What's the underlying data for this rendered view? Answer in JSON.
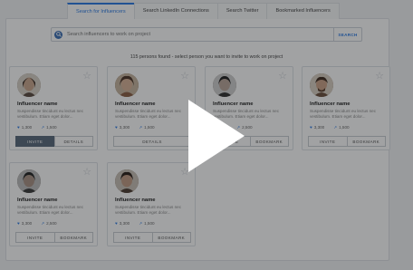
{
  "tabs": [
    {
      "label": "Search for Influencers"
    },
    {
      "label": "Search LinkedIn Connections"
    },
    {
      "label": "Search Twitter"
    },
    {
      "label": "Bookmarked Influencers"
    }
  ],
  "search": {
    "placeholder": "Search influencers to work on project",
    "button_label": "SEARCH"
  },
  "results_text": "115 persons found - select person you want to invite to work on project",
  "cards": [
    {
      "name": "Influencer name",
      "desc": "Suspendisse tincidunt eu lectus nec vestibulum. Etiam eget dolor...",
      "stat1": "1,300",
      "stat2": "1,500",
      "btn1": "INVITE",
      "btn2": "DETAILS",
      "btn1_primary": true
    },
    {
      "name": "Influencer name",
      "desc": "Suspendisse tincidunt eu lectus nec vestibulum. Etiam eget dolor...",
      "stat1": "3,300",
      "stat2": "1,500",
      "btn1": "DETAILS",
      "btn2": ""
    },
    {
      "name": "Influencer name",
      "desc": "Suspendisse tincidunt eu lectus nec vestibulum. Etiam eget dolor...",
      "stat1": "3,300",
      "stat2": "2,500",
      "btn1": "INVITE",
      "btn2": "BOOKMARK"
    },
    {
      "name": "Influencer name",
      "desc": "Suspendisse tincidunt eu lectus nec vestibulum. Etiam eget dolor...",
      "stat1": "3,300",
      "stat2": "1,500",
      "btn1": "INVITE",
      "btn2": "BOOKMARK"
    },
    {
      "name": "Influencer name",
      "desc": "Suspendisse tincidunt eu lectus nec vestibulum. Etiam eget dolor...",
      "stat1": "3,300",
      "stat2": "2,500",
      "btn1": "INVITE",
      "btn2": "BOOKMARK"
    },
    {
      "name": "Influencer name",
      "desc": "Suspendisse tincidunt eu lectus nec vestibulum. Etiam eget dolor...",
      "stat1": "3,300",
      "stat2": "1,500",
      "btn1": "INVITE",
      "btn2": "BOOKMARK"
    }
  ],
  "colors": {
    "accent": "#2c7be5",
    "primary_button": "#596a7c",
    "overlay": "rgba(20,22,26,0.40)"
  },
  "icons": {
    "search": "search-icon",
    "favorite": "star-icon",
    "play": "play-icon"
  }
}
